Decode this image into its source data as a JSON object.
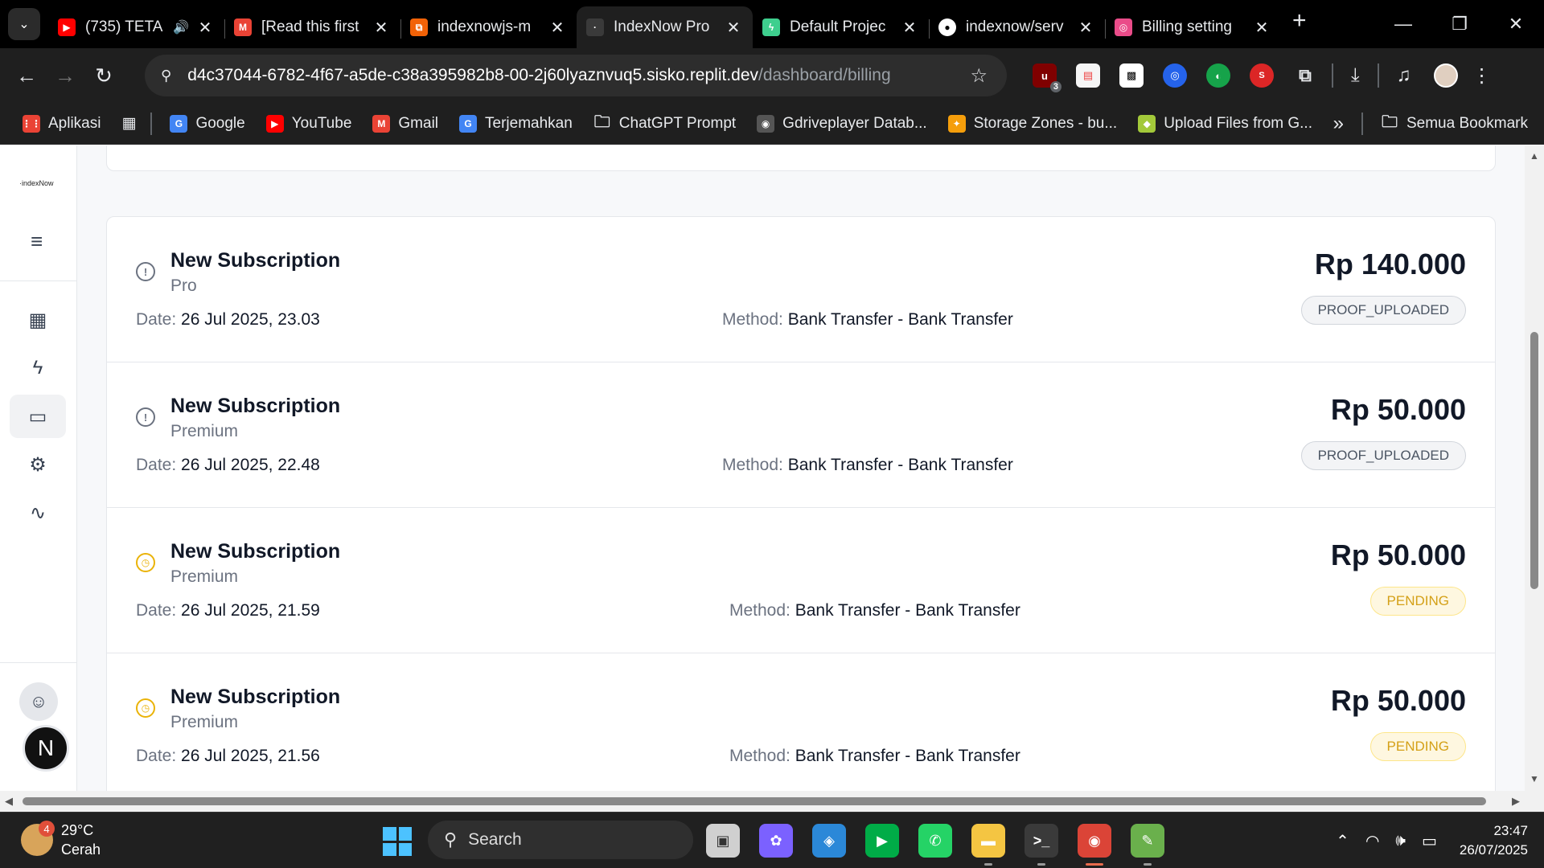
{
  "browser": {
    "tabs": [
      {
        "label": "(735) TETA",
        "favicon": "youtube-icon",
        "color": "#ff0000",
        "glyph": "▶",
        "sound": true
      },
      {
        "label": "[Read this first",
        "favicon": "gmail-icon",
        "color": "#ea4335",
        "glyph": "M"
      },
      {
        "label": "indexnowjs-m",
        "favicon": "replit-icon",
        "color": "#f26207",
        "glyph": "⧉"
      },
      {
        "label": "IndexNow Pro",
        "favicon": "indexnow-icon",
        "color": "#3a3a3a",
        "glyph": "·",
        "active": true
      },
      {
        "label": "Default Projec",
        "favicon": "supabase-icon",
        "color": "#3ecf8e",
        "glyph": "ϟ"
      },
      {
        "label": "indexnow/serv",
        "favicon": "github-icon",
        "color": "#ffffff",
        "glyph": "●"
      },
      {
        "label": "Billing setting",
        "favicon": "dribbble-icon",
        "color": "#ea4c89",
        "glyph": "◎"
      }
    ],
    "url_host": "d4c37044-6782-4f67-a5de-c38a395982b8-00-2j60lyaznvuq5.sisko.replit.dev",
    "url_path": "/dashboard/billing",
    "extension_badge": "3",
    "bookmarks": [
      {
        "label": "Aplikasi",
        "icon": "apps-grid-icon",
        "color": "#ea4335",
        "glyph": "⋮⋮"
      },
      {
        "label": "Google",
        "icon": "google-icon",
        "color": "#4285f4",
        "glyph": "G"
      },
      {
        "label": "YouTube",
        "icon": "youtube-icon",
        "color": "#ff0000",
        "glyph": "▶"
      },
      {
        "label": "Gmail",
        "icon": "gmail-icon",
        "color": "#ea4335",
        "glyph": "M"
      },
      {
        "label": "Terjemahkan",
        "icon": "translate-icon",
        "color": "#4285f4",
        "glyph": "G"
      },
      {
        "label": "ChatGPT Prompt",
        "icon": "folder-icon",
        "color": "transparent",
        "glyph": "🗀"
      },
      {
        "label": "Gdriveplayer Datab...",
        "icon": "globe-icon",
        "color": "#555555",
        "glyph": "◉"
      },
      {
        "label": "Storage Zones - bu...",
        "icon": "bunny-icon",
        "color": "#f59e0b",
        "glyph": "✦"
      },
      {
        "label": "Upload Files from G...",
        "icon": "cube-icon",
        "color": "#a3c93a",
        "glyph": "◆"
      }
    ],
    "bookmarks_more": "»",
    "all_bookmarks_label": "Semua Bookmark"
  },
  "app": {
    "logo_text": "·indexNow",
    "user_initial": "N",
    "sidebar_items": [
      {
        "name": "dashboard-icon",
        "glyph": "▦"
      },
      {
        "name": "lightning-icon",
        "glyph": "ϟ"
      },
      {
        "name": "credit-card-icon",
        "glyph": "▭",
        "active": true
      },
      {
        "name": "settings-gear-icon",
        "glyph": "⚙"
      },
      {
        "name": "activity-icon",
        "glyph": "∿"
      }
    ],
    "transactions": [
      {
        "title": "New Subscription",
        "plan": "Pro",
        "date_label": "Date:",
        "date": "26 Jul 2025, 23.03",
        "method_label": "Method:",
        "method": "Bank Transfer - Bank Transfer",
        "amount": "Rp 140.000",
        "status": "PROOF_UPLOADED",
        "status_type": "proof"
      },
      {
        "title": "New Subscription",
        "plan": "Premium",
        "date_label": "Date:",
        "date": "26 Jul 2025, 22.48",
        "method_label": "Method:",
        "method": "Bank Transfer - Bank Transfer",
        "amount": "Rp 50.000",
        "status": "PROOF_UPLOADED",
        "status_type": "proof"
      },
      {
        "title": "New Subscription",
        "plan": "Premium",
        "date_label": "Date:",
        "date": "26 Jul 2025, 21.59",
        "method_label": "Method:",
        "method": "Bank Transfer - Bank Transfer",
        "amount": "Rp 50.000",
        "status": "PENDING",
        "status_type": "pending"
      },
      {
        "title": "New Subscription",
        "plan": "Premium",
        "date_label": "Date:",
        "date": "26 Jul 2025, 21.56",
        "method_label": "Method:",
        "method": "Bank Transfer - Bank Transfer",
        "amount": "Rp 50.000",
        "status": "PENDING",
        "status_type": "pending"
      }
    ]
  },
  "taskbar": {
    "weather_temp": "29°C",
    "weather_desc": "Cerah",
    "weather_badge": "4",
    "search_placeholder": "Search",
    "apps": [
      {
        "name": "task-view-icon",
        "color": "#d0d0d0",
        "glyph": "▣"
      },
      {
        "name": "copilot-icon",
        "color": "#7b61ff",
        "glyph": "✿"
      },
      {
        "name": "m365-icon",
        "color": "#2b88d8",
        "glyph": "◈"
      },
      {
        "name": "google-meet-icon",
        "color": "#00ac47",
        "glyph": "▶"
      },
      {
        "name": "whatsapp-icon",
        "color": "#25d366",
        "glyph": "✆"
      },
      {
        "name": "file-explorer-icon",
        "color": "#f4c542",
        "glyph": "▬"
      },
      {
        "name": "terminal-icon",
        "color": "#3a3a3a",
        "glyph": ">_"
      },
      {
        "name": "chrome-icon",
        "color": "#db4437",
        "glyph": "◉",
        "active": true
      },
      {
        "name": "notepad-icon",
        "color": "#6ab04c",
        "glyph": "✎"
      }
    ],
    "time": "23:47",
    "date": "26/07/2025"
  }
}
